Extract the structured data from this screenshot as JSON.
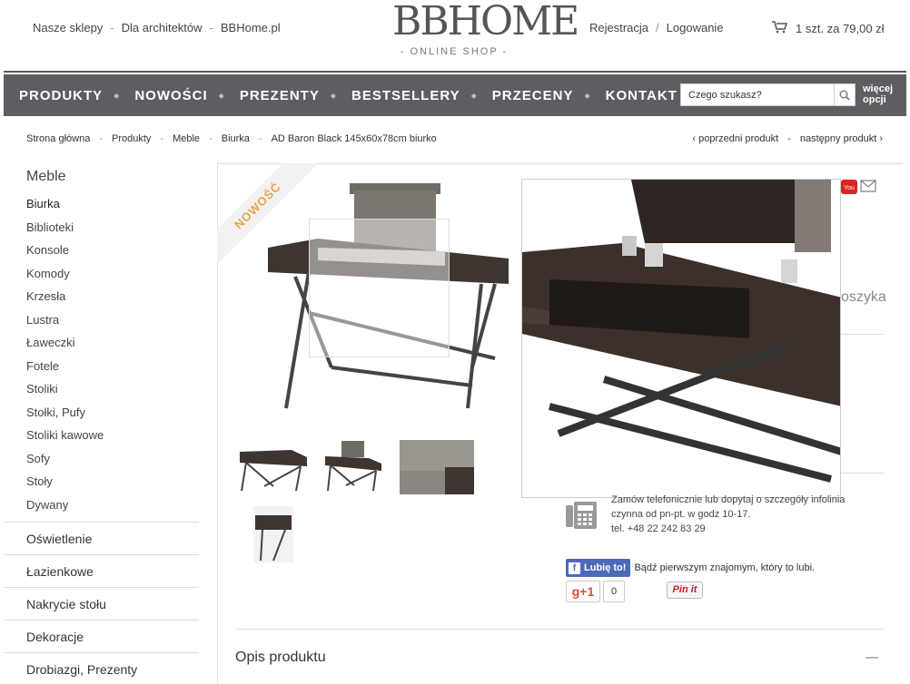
{
  "top_links": [
    "Nasze sklepy",
    "Dla architektów",
    "BBHome.pl"
  ],
  "separator": "-",
  "logo": {
    "main": "BBHOME",
    "sub": "- ONLINE SHOP -"
  },
  "account": {
    "register": "Rejestracja",
    "sep": "/",
    "login": "Logowanie"
  },
  "cart": {
    "summary": "1 szt. za 79,00 zł",
    "icon": "cart-icon"
  },
  "nav": {
    "items": [
      "PRODUKTY",
      "NOWOŚCI",
      "PREZENTY",
      "BESTSELLERY",
      "PRZECENY",
      "KONTAKT"
    ],
    "search_placeholder": "Czego szukasz?",
    "more_line1": "więcej",
    "more_line2": "opcji"
  },
  "breadcrumb": [
    "Strona główna",
    "Produkty",
    "Meble",
    "Biurka",
    "AD Baron Black 145x60x78cm biurko"
  ],
  "prev_product": "‹ poprzedni produkt",
  "next_product": "następny produkt ›",
  "sidebar": {
    "heading": "Meble",
    "subitems": [
      "Biurka",
      "Biblioteki",
      "Konsole",
      "Komody",
      "Krzesła",
      "Lustra",
      "Ławeczki",
      "Fotele",
      "Stoliki",
      "Stołki, Pufy",
      "Stoliki kawowe",
      "Sofy",
      "Stoły",
      "Dywany"
    ],
    "categories": [
      "Oświetlenie",
      "Łazienkowe",
      "Nakrycie stołu",
      "Dekoracje",
      "Drobiazgi, Prezenty"
    ]
  },
  "ribbon": "NOWOŚĆ",
  "koszyka_fragment": "oszyka",
  "contact": {
    "line1": "Zamów telefonicznie lub dopytaj o szczegóły infolinia",
    "line2": "czynna od pn-pt. w godz 10-17.",
    "phone": "tel. +48 22 242 83 29"
  },
  "facebook": {
    "button": "Lubię to!",
    "text": "Bądź pierwszym znajomym, który to lubi."
  },
  "gplus": {
    "label": "g+1",
    "count": "0"
  },
  "pinterest": "Pin it",
  "description_heading": "Opis produktu",
  "colors": {
    "nav_bg": "#5d5e61",
    "ribbon_text": "#e8a44a",
    "fb_blue": "#4c69ba"
  }
}
